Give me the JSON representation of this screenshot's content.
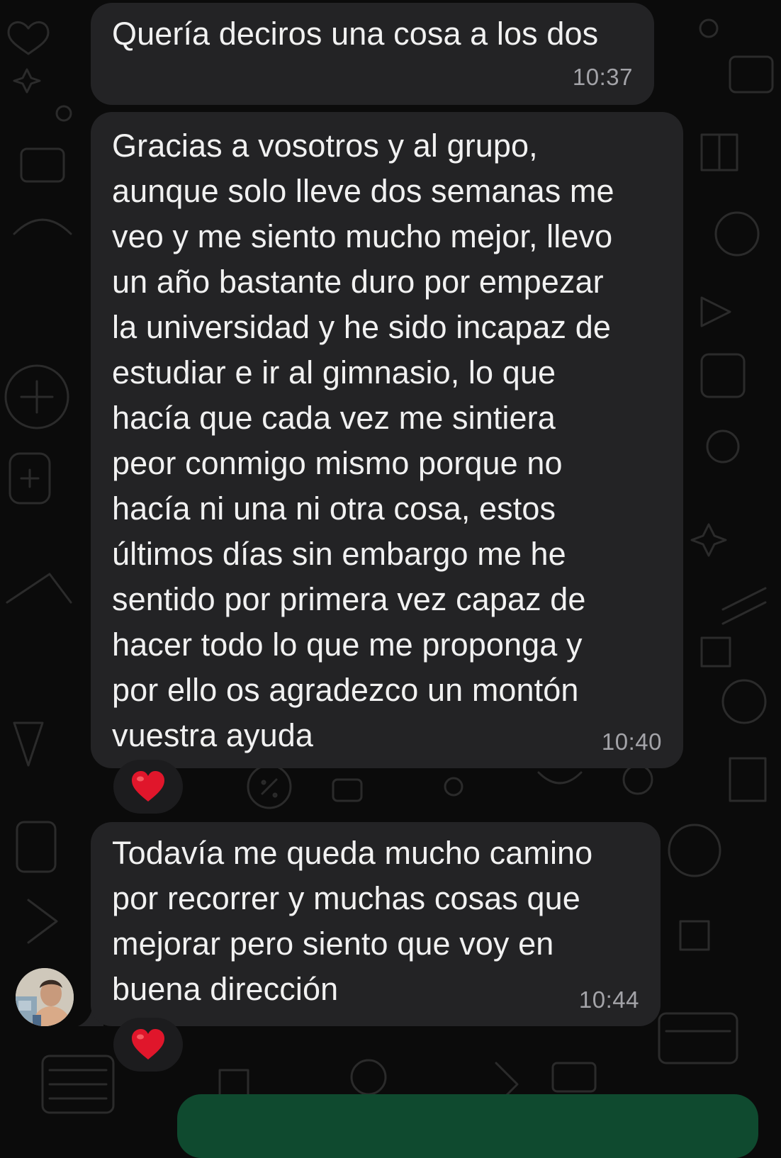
{
  "chat": {
    "messages": [
      {
        "text": "Quería deciros una cosa a los dos",
        "time": "10:37",
        "reaction": null
      },
      {
        "text": "Gracias a vosotros y al grupo,\naunque solo lleve dos semanas me\nveo y me siento mucho mejor, llevo\nun año bastante duro por empezar\nla universidad y he sido incapaz de\nestudiar e ir al gimnasio, lo que\nhacía que cada vez me sintiera\npeor conmigo mismo porque no\nhacía ni una ni otra cosa, estos\núltimos días sin embargo me he\nsentido por primera vez capaz de\nhacer todo lo que me proponga y\npor ello os agradezco un montón\nvuestra ayuda",
        "time": "10:40",
        "reaction": "heart-icon"
      },
      {
        "text": "Todavía me queda mucho camino\npor recorrer y muchas cosas que\nmejorar pero siento que voy en\nbuena dirección",
        "time": "10:44",
        "reaction": "heart-icon"
      }
    ],
    "avatar": "sender-avatar"
  },
  "colors": {
    "background": "#0b0b0b",
    "bubble_incoming": "#232325",
    "text": "#f1f1f1",
    "timestamp": "#a3a3a8",
    "reaction_heart": "#e0162b",
    "bubble_outgoing": "#0f4a2f"
  }
}
